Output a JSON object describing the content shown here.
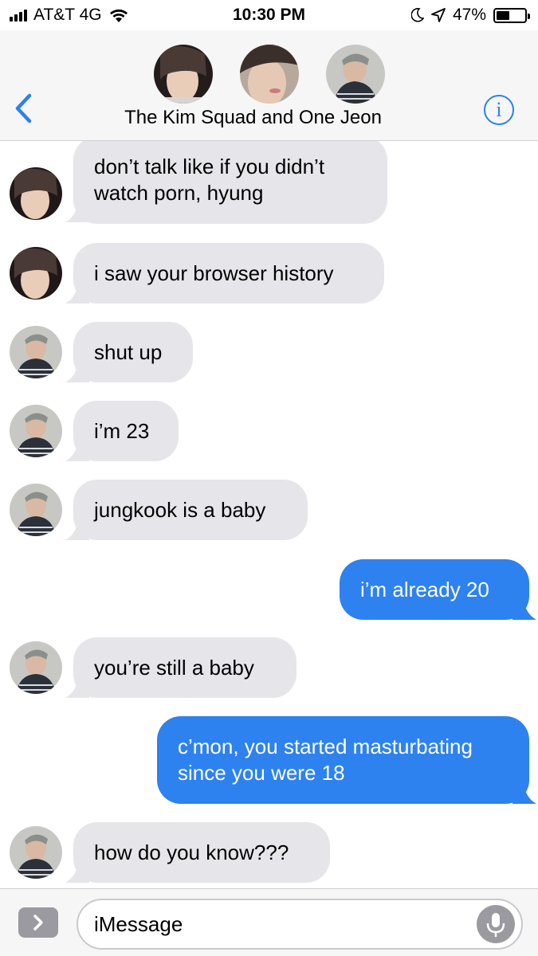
{
  "status_bar": {
    "carrier": "AT&T 4G",
    "time": "10:30 PM",
    "battery": "47%",
    "battery_level": 0.47
  },
  "header": {
    "group_name": "The Kim Squad and One Jeon",
    "participants": [
      "avatar-1",
      "avatar-2",
      "avatar-3"
    ]
  },
  "messages": [
    {
      "sender": "incoming",
      "text": "don’t talk like if you didn’t watch porn, hyung"
    },
    {
      "sender": "incoming",
      "text": "i saw your browser history"
    },
    {
      "sender": "incoming",
      "text": "shut up"
    },
    {
      "sender": "incoming",
      "text": "i’m 23"
    },
    {
      "sender": "incoming",
      "text": "jungkook is a baby"
    },
    {
      "sender": "outgoing",
      "text": "i’m already 20"
    },
    {
      "sender": "incoming",
      "text": "you’re still a baby"
    },
    {
      "sender": "outgoing",
      "text": "c’mon, you started masturbating since you were 18"
    },
    {
      "sender": "incoming",
      "text": "how do you know???"
    }
  ],
  "compose": {
    "placeholder": "iMessage"
  },
  "colors": {
    "accent": "#2d80f0",
    "incoming_bubble": "#e6e5ea",
    "outgoing_bubble": "#2d82f0"
  }
}
